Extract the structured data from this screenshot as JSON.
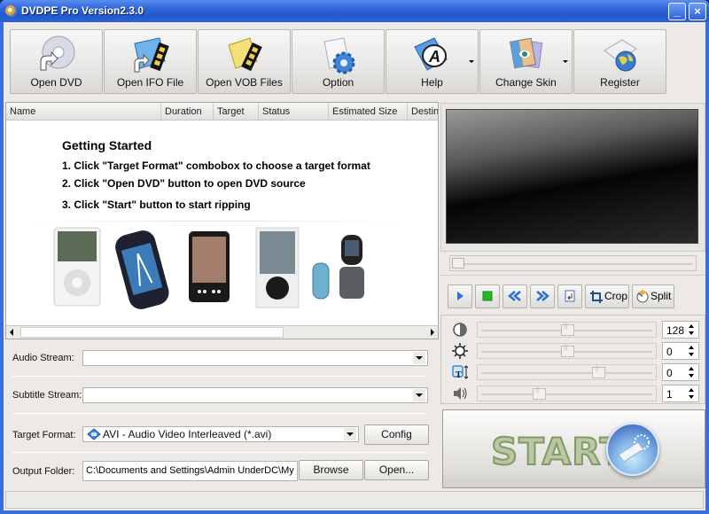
{
  "window": {
    "title": "DVDPE Pro Version2.3.0",
    "minimize_label": "_",
    "close_label": "×"
  },
  "toolbar": {
    "buttons": [
      {
        "label": "Open DVD",
        "icon": "dvd-disc-icon",
        "has_dropdown": false
      },
      {
        "label": "Open IFO File",
        "icon": "ifo-file-icon",
        "has_dropdown": false
      },
      {
        "label": "Open VOB Files",
        "icon": "vob-files-icon",
        "has_dropdown": false
      },
      {
        "label": "Option",
        "icon": "gear-icon",
        "has_dropdown": false
      },
      {
        "label": "Help",
        "icon": "help-icon",
        "has_dropdown": true
      },
      {
        "label": "Change Skin",
        "icon": "skin-icon",
        "has_dropdown": true
      },
      {
        "label": "Register",
        "icon": "register-globe-icon",
        "has_dropdown": false
      }
    ]
  },
  "file_list": {
    "columns": [
      "Name",
      "Duration",
      "Target",
      "Status",
      "Estimated Size",
      "Destin"
    ],
    "getting_started": {
      "title": "Getting Started",
      "steps": [
        "1. Click \"Target Format\" combobox to choose a target format",
        "2. Click \"Open DVD\" button to open DVD source",
        "3. Click \"Start\" button to start ripping"
      ]
    },
    "devices": [
      "ipod",
      "psp",
      "pocket-pc",
      "zune",
      "mobile-phone"
    ]
  },
  "settings": {
    "audio_stream": {
      "label": "Audio Stream:",
      "value": ""
    },
    "subtitle_stream": {
      "label": "Subtitle Stream:",
      "value": ""
    },
    "target_format": {
      "label": "Target Format:",
      "value": "AVI - Audio Video Interleaved (*.avi)",
      "config_label": "Config"
    },
    "output_folder": {
      "label": "Output Folder:",
      "value": "C:\\Documents and Settings\\Admin UnderDC\\My D",
      "browse_label": "Browse",
      "open_label": "Open..."
    }
  },
  "player": {
    "seek_position": 0,
    "controls": {
      "play": "play-icon",
      "stop": "stop-icon",
      "rewind": "rewind-icon",
      "forward": "fast-forward-icon",
      "snapshot": "snapshot-icon",
      "crop_label": "Crop",
      "split_label": "Split"
    }
  },
  "adjustments": [
    {
      "name": "contrast",
      "icon": "contrast-icon",
      "value": "128",
      "slider_fraction": 0.5
    },
    {
      "name": "brightness",
      "icon": "brightness-icon",
      "value": "0",
      "slider_fraction": 0.5
    },
    {
      "name": "subtitle-position",
      "icon": "text-position-icon",
      "value": "0",
      "slider_fraction": 0.69
    },
    {
      "name": "volume",
      "icon": "volume-icon",
      "value": "1",
      "slider_fraction": 0.33
    }
  ],
  "start": {
    "label": "START"
  },
  "status_bar": {
    "text": ""
  }
}
